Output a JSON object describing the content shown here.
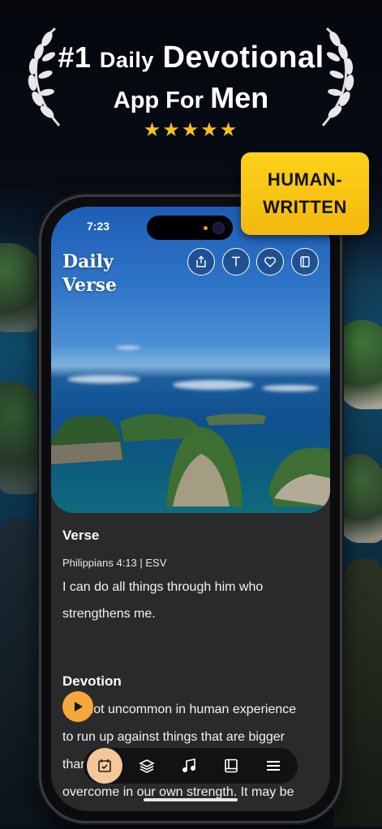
{
  "headline": {
    "line1_prefix": "#1",
    "line1_small": "Daily",
    "line1_big": "Devotional",
    "line2_small": "App For",
    "line2_big": "Men",
    "stars": "★★★★★"
  },
  "badge": {
    "line1": "HUMAN-",
    "line2": "WRITTEN"
  },
  "status": {
    "time": "7:23"
  },
  "app": {
    "title_line1": "Daily",
    "title_line2": "Verse",
    "toolbar": [
      "share-icon",
      "text-size-icon",
      "heart-icon",
      "bookmark-icon"
    ],
    "verse": {
      "heading": "Verse",
      "reference": "Philippians 4:13 | ESV",
      "text_line1": "I can do all things through him who",
      "text_line2": "strengthens me."
    },
    "devotion": {
      "heading": "Devotion",
      "line1": "It is not uncommon in human experience",
      "line2": "to run up against things that are bigger",
      "line3": "than",
      "line4": "overcome in our own strength. It may be"
    },
    "tabs": [
      "calendar-check-icon",
      "layers-icon",
      "music-note-icon",
      "book-icon",
      "menu-icon"
    ],
    "accent": "#f5a83a"
  }
}
